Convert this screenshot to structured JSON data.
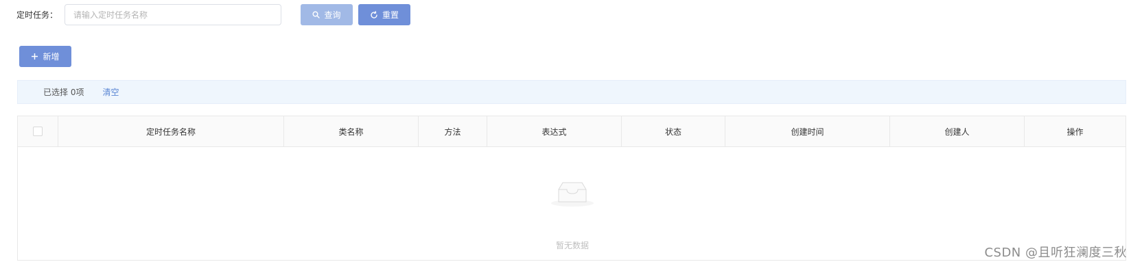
{
  "search": {
    "label": "定时任务：",
    "placeholder": "请输入定时任务名称",
    "value": ""
  },
  "buttons": {
    "query": "查询",
    "reset": "重置",
    "add": "新增"
  },
  "selection": {
    "text": "已选择 0项",
    "clear": "清空"
  },
  "table": {
    "columns": [
      "定时任务名称",
      "类名称",
      "方法",
      "表达式",
      "状态",
      "创建时间",
      "创建人",
      "操作"
    ],
    "rows": [],
    "empty_text": "暂无数据"
  },
  "watermark": "CSDN @且听狂澜度三秋",
  "colors": {
    "primary": "#6f8fd9",
    "primary_disabled": "#a1b9e6",
    "info_bg": "#eff6fd",
    "link": "#5a86d4"
  },
  "icons": {
    "query": "search-icon",
    "reset": "refresh-icon",
    "add": "plus-icon",
    "empty": "empty-inbox-icon"
  }
}
